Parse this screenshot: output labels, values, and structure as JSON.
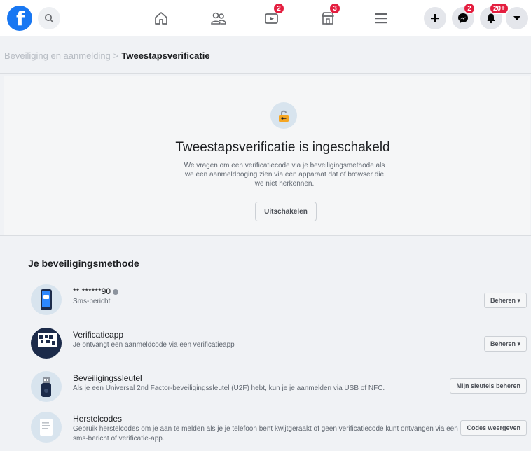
{
  "nav": {
    "badges": {
      "watch": "2",
      "marketplace": "3",
      "messenger": "2",
      "notifications": "20+"
    }
  },
  "breadcrumb": {
    "parent": "Beveiliging en aanmelding",
    "separator": ">",
    "current": "Tweestapsverificatie"
  },
  "status": {
    "title": "Tweestapsverificatie is ingeschakeld",
    "description": "We vragen om een verificatiecode via je beveiligingsmethode als we een aanmeldpoging zien via een apparaat dat of browser die we niet herkennen.",
    "disable_label": "Uitschakelen"
  },
  "methods": {
    "heading": "Je beveiligingsmethode",
    "items": [
      {
        "title": "** ******90",
        "subtitle": "Sms-bericht",
        "button": "Beheren ▾"
      },
      {
        "title": "Verificatieapp",
        "subtitle": "Je ontvangt een aanmeldcode via een verificatieapp",
        "button": "Beheren ▾"
      },
      {
        "title": "Beveiligingssleutel",
        "subtitle": "Als je een Universal 2nd Factor-beveiligingssleutel (U2F) hebt, kun je je aanmelden via USB of NFC.",
        "button": "Mijn sleutels beheren"
      },
      {
        "title": "Herstelcodes",
        "subtitle": "Gebruik herstelcodes om je aan te melden als je je telefoon bent kwijtgeraakt of geen verificatiecode kunt ontvangen via een sms-bericht of verificatie-app.",
        "button": "Codes weergeven"
      }
    ]
  },
  "colors": {
    "brand": "#1877f2",
    "badge": "#e41e3f",
    "lock": "#f5a623"
  }
}
